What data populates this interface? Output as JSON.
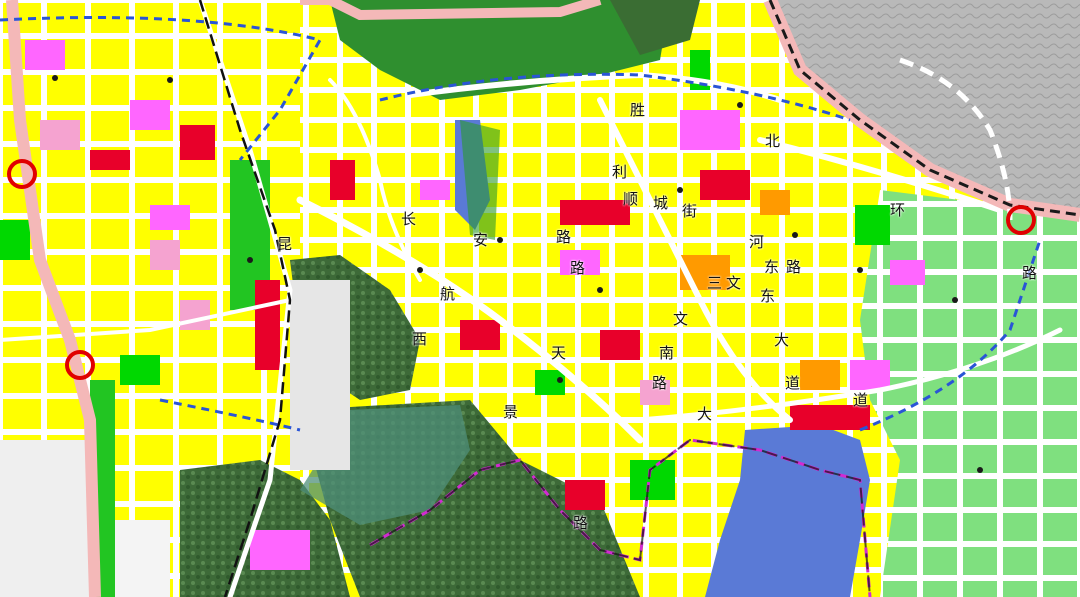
{
  "map": {
    "colors": {
      "residential": "#ffff00",
      "commercial": "#e8002a",
      "public_service": "#ff66ff",
      "education": "#f5a3d0",
      "green_space": "#00d800",
      "park_green": "#22b822",
      "industrial": "#b07a4a",
      "mixed_use": "#ff9a00",
      "road": "#ffffff",
      "water": "#5a7ad6",
      "mountain_forest": "#3f6b3a",
      "terrain_grey": "#b8b8b8",
      "expressway": "#f4b8b8",
      "boundary_dashed_blue": "#2a55d6",
      "boundary_magenta": "#d22ad2",
      "railway": "#111111",
      "interchange_marker": "#e00000"
    },
    "icons": [
      "interchange-marker-icon",
      "facility-point-icon"
    ],
    "labels": {
      "sheng": "胜",
      "bei": "北",
      "li": "利",
      "shun": "顺",
      "cheng": "城",
      "jie": "街",
      "chang": "长",
      "an": "安",
      "lu_1": "路",
      "lu_2": "路",
      "kun": "昆",
      "hang": "航",
      "xi": "西",
      "tian": "天",
      "jing": "景",
      "lu_3": "路",
      "he": "河",
      "dong": "东",
      "lu_4": "路",
      "huan": "环",
      "lu_5": "路",
      "sanwen_san": "三",
      "sanwen_wen": "文",
      "dong_2": "东",
      "wen": "文",
      "nan": "南",
      "lu_6": "路",
      "da_1": "大",
      "dao_1": "道",
      "da_2": "大",
      "dao_2": "道"
    }
  }
}
